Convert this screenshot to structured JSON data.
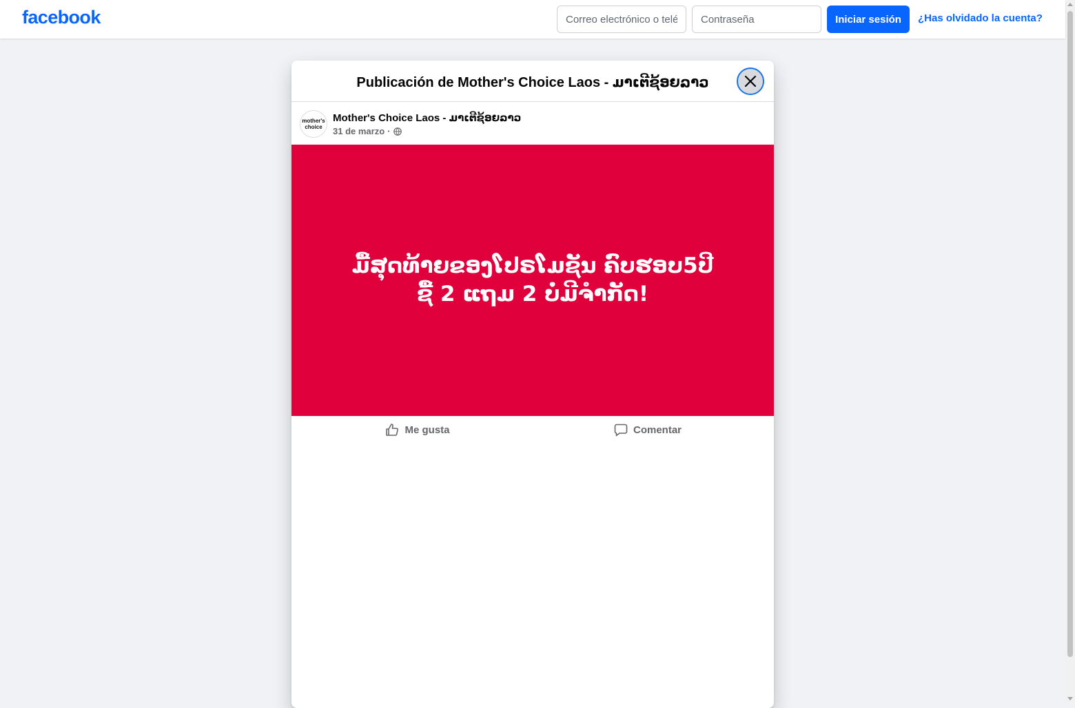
{
  "header": {
    "logo_text": "facebook",
    "email_placeholder": "Correo electrónico o teléfono",
    "password_placeholder": "Contraseña",
    "login_label": "Iniciar sesión",
    "forgot_label": "¿Has olvidado la cuenta?"
  },
  "modal": {
    "title": "Publicación de Mother's Choice Laos - ມາເຕີຊ້ອຍລາວ",
    "close_icon": "close-icon"
  },
  "post": {
    "page_name": "Mother's Choice Laos - ມາເຕີຊ້ອຍລາວ",
    "avatar_text_line1": "mother's",
    "avatar_text_line2": "choice",
    "date": "31 de marzo",
    "separator": "·",
    "privacy_icon": "globe-icon",
    "banner_line1": "ມື້ສຸດທ້າຍຂອງໂປຣໂມຊັນ ຄົບຮອບ5ປີ",
    "banner_line2": "ຊື້ 2 ແຖມ 2 ບໍ່ມີຈຳກັດ!",
    "banner_color": "#e0003c"
  },
  "actions": {
    "like_label": "Me gusta",
    "comment_label": "Comentar"
  },
  "colors": {
    "brand": "#0866ff",
    "background": "#f0f2f5"
  }
}
